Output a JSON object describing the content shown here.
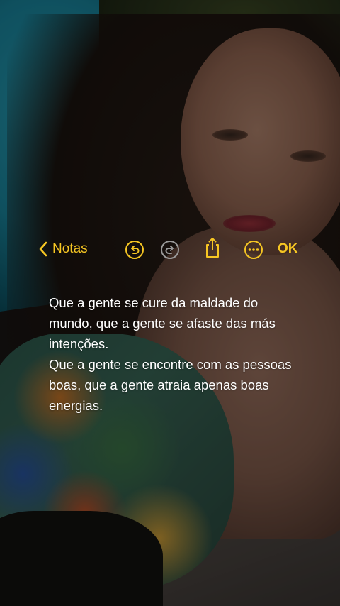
{
  "toolbar": {
    "back_label": "Notas",
    "back_icon": "chevron-left-icon",
    "undo_icon": "undo-icon",
    "redo_icon": "redo-icon",
    "share_icon": "share-icon",
    "more_icon": "ellipsis-circle-icon",
    "done_label": "OK",
    "accent_color": "#f6c623",
    "disabled_color": "#9a9a9a"
  },
  "note": {
    "paragraphs": [
      "Que a gente se cure da maldade do mundo, que a gente se afaste das más intenções.",
      "Que a gente se encontre com as pessoas boas, que a gente atraia apenas boas energias."
    ]
  }
}
